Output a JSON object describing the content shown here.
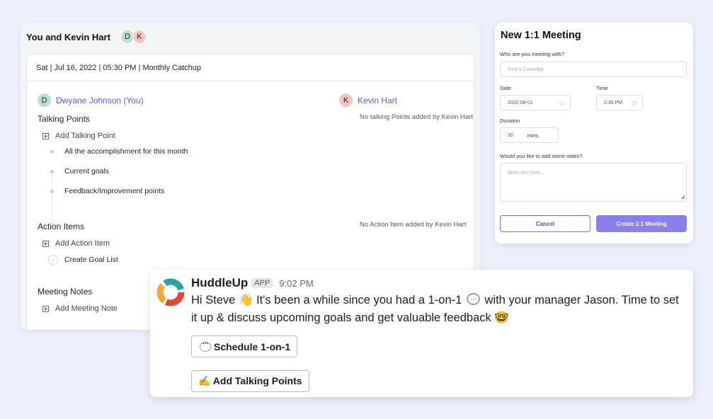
{
  "oneonone": {
    "title": "You and Kevin Hart",
    "avatars": [
      "D",
      "K"
    ],
    "meta": "Sat | Jul 16, 2022 | 05:30 PM | Monthly Catchup",
    "you": {
      "initial": "D",
      "name": "Dwyane Johnson (You)"
    },
    "other": {
      "initial": "K",
      "name": "Kevin Hart"
    },
    "talking_points": {
      "title": "Talking Points",
      "add_label": "Add Talking Point",
      "items": [
        "All the accomplishment for this month",
        "Current goals",
        "Feedback/Improvement points"
      ],
      "other_empty": "No talking Points added by Kevin Hart"
    },
    "action_items": {
      "title": "Action Items",
      "add_label": "Add Action Item",
      "items": [
        "Create Goal List"
      ],
      "other_empty": "No Action Item added by Kevin Hart"
    },
    "meeting_notes": {
      "title": "Meeting Notes",
      "add_label": "Add Meeting Note"
    }
  },
  "form": {
    "title": "New 1:1 Meeting",
    "who_label": "Who are you meeting with?",
    "who_placeholder": "Find a Coworker",
    "date_label": "Date",
    "date_value": "2022-08-01",
    "time_label": "Time",
    "time_value": "2:30 PM",
    "duration_label": "Duration",
    "duration_value": "30",
    "duration_unit": "mins",
    "notes_label": "Would you like to add some notes?",
    "notes_placeholder": "Enter text here...",
    "cancel_label": "Cancel",
    "create_label": "Create 1:1 Meeting"
  },
  "message": {
    "app_name": "HuddleUp",
    "badge": "APP",
    "time": "9:02 PM",
    "text_part1": "Hi Steve 👋 It's been a while since you had a 1-on-1",
    "text_part2": "with your manager Jason. Time to set it up & discuss upcoming goals and get valuable feedback 🤓",
    "btn_schedule": "Schedule 1-on-1",
    "btn_talking": "✍️ Add Talking Points"
  },
  "colors": {
    "background": "#eceefc",
    "accent": "#8b7ff0",
    "link": "#6257d6",
    "avatar_d": "#b9e1d2",
    "avatar_k": "#f5c5c6"
  }
}
